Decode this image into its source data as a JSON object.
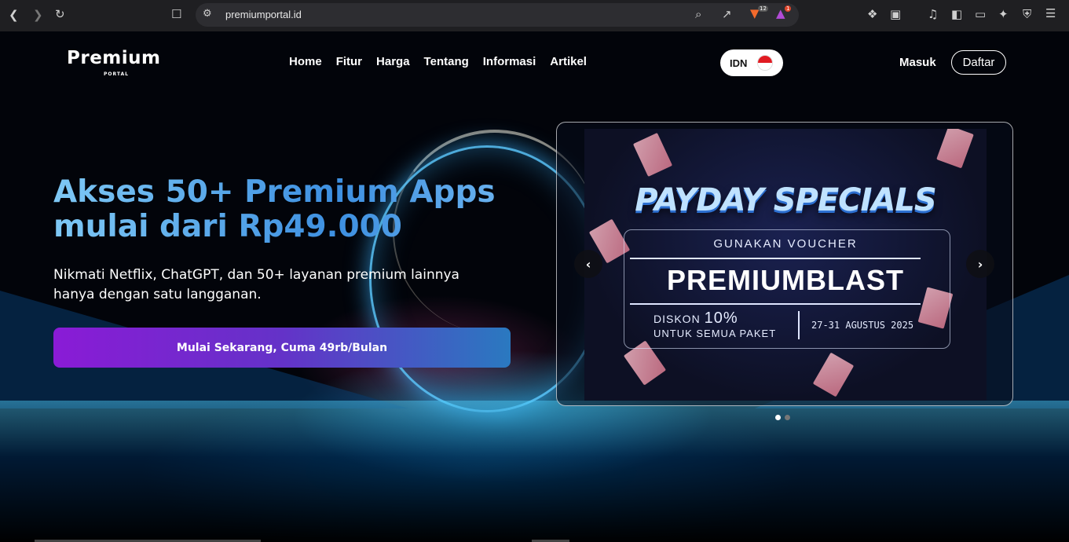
{
  "browser": {
    "url": "premiumportal.id",
    "badges": {
      "shields_count": "12",
      "rewards_count": "1"
    }
  },
  "header": {
    "logo_text": "Premium",
    "logo_sub": "PORTAL",
    "nav": [
      "Home",
      "Fitur",
      "Harga",
      "Tentang",
      "Informasi",
      "Artikel"
    ],
    "language": "IDN",
    "login": "Masuk",
    "register": "Daftar"
  },
  "hero": {
    "title_line1": "Akses 50+ Premium Apps",
    "title_line2": "mulai dari Rp49.000",
    "subtitle_line1": "Nikmati Netflix, ChatGPT, dan 50+ layanan premium lainnya",
    "subtitle_line2": "hanya dengan satu langganan.",
    "cta": "Mulai Sekarang, Cuma 49rb/Bulan"
  },
  "carousel": {
    "slide": {
      "headline": "PAYDAY SPECIALS",
      "voucher_label": "GUNAKAN VOUCHER",
      "voucher_code": "PREMIUMBLAST",
      "discount_label": "DISKON",
      "discount_value": "10%",
      "discount_scope": "UNTUK SEMUA PAKET",
      "date_range": "27-31 AGUSTUS 2025"
    },
    "prev_icon": "‹",
    "next_icon": "›",
    "active_index": 0,
    "total_slides": 2
  },
  "colors": {
    "accent_gradient_start": "#8a1bd6",
    "accent_gradient_end": "#2a79c0",
    "title_blue": "#3d8fe0"
  }
}
